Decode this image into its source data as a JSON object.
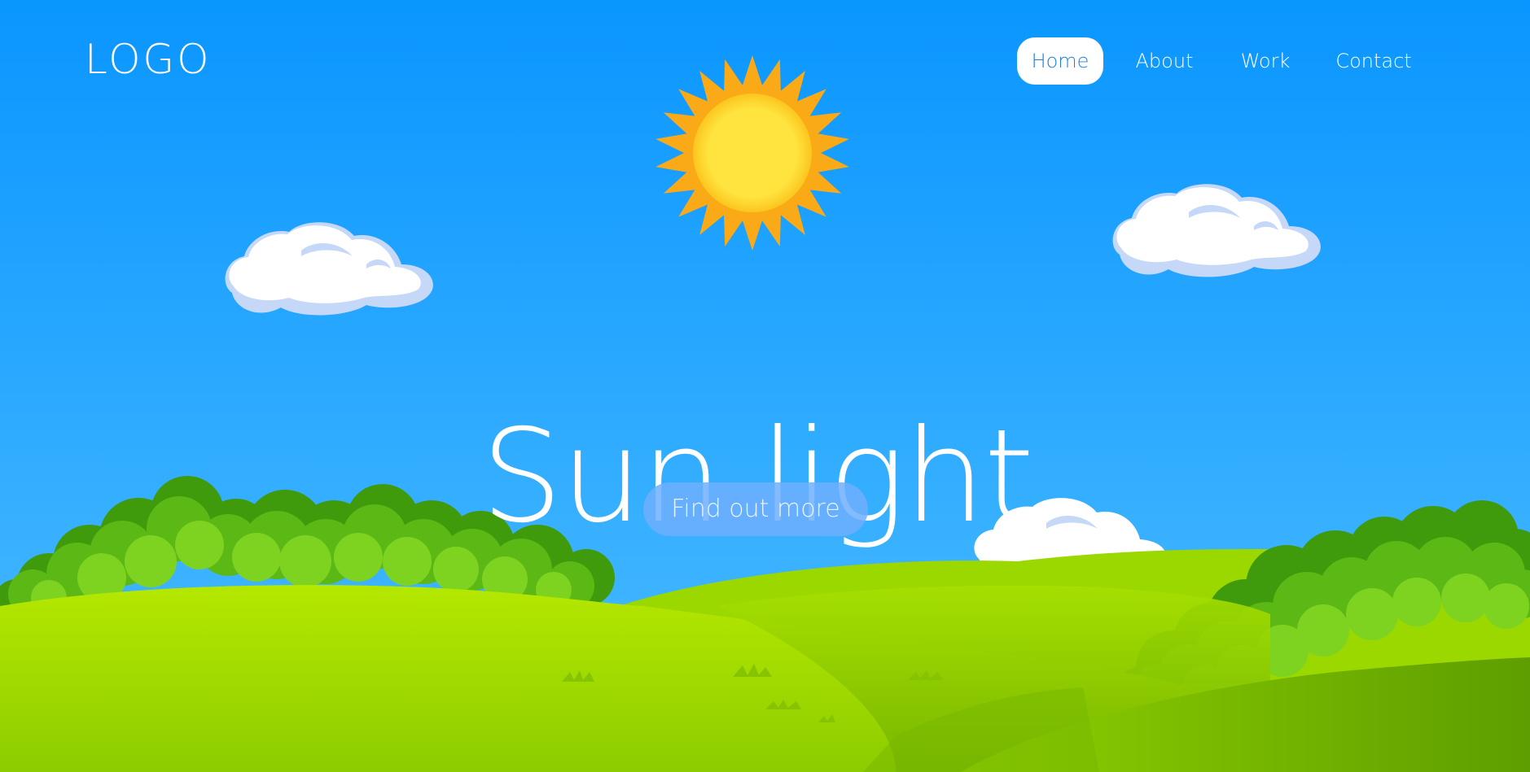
{
  "header": {
    "logo_text": "LOGO"
  },
  "nav": {
    "items": [
      {
        "label": "Home",
        "active": true
      },
      {
        "label": "About",
        "active": false
      },
      {
        "label": "Work",
        "active": false
      },
      {
        "label": "Contact",
        "active": false
      }
    ]
  },
  "hero": {
    "title": "Sun light",
    "cta_label": "Find out more"
  },
  "colors": {
    "sky_top": "#0a96ff",
    "sky_bottom": "#4cbcff",
    "sun_rays": "#fbaa17",
    "sun_core": "#ffe23c",
    "grass_light": "#b5e800",
    "grass_dark": "#6aa500",
    "bush_dark": "#3f9a0c",
    "bush_light": "#7ed321",
    "cloud_white": "#ffffff",
    "cloud_shade": "#c6d8f7",
    "cta_bg": "#6eafff",
    "nav_active_text": "#1e7fe0"
  },
  "icons": {
    "sun": "sun-icon",
    "cloud": "cloud-icon",
    "bush": "bush-icon"
  }
}
